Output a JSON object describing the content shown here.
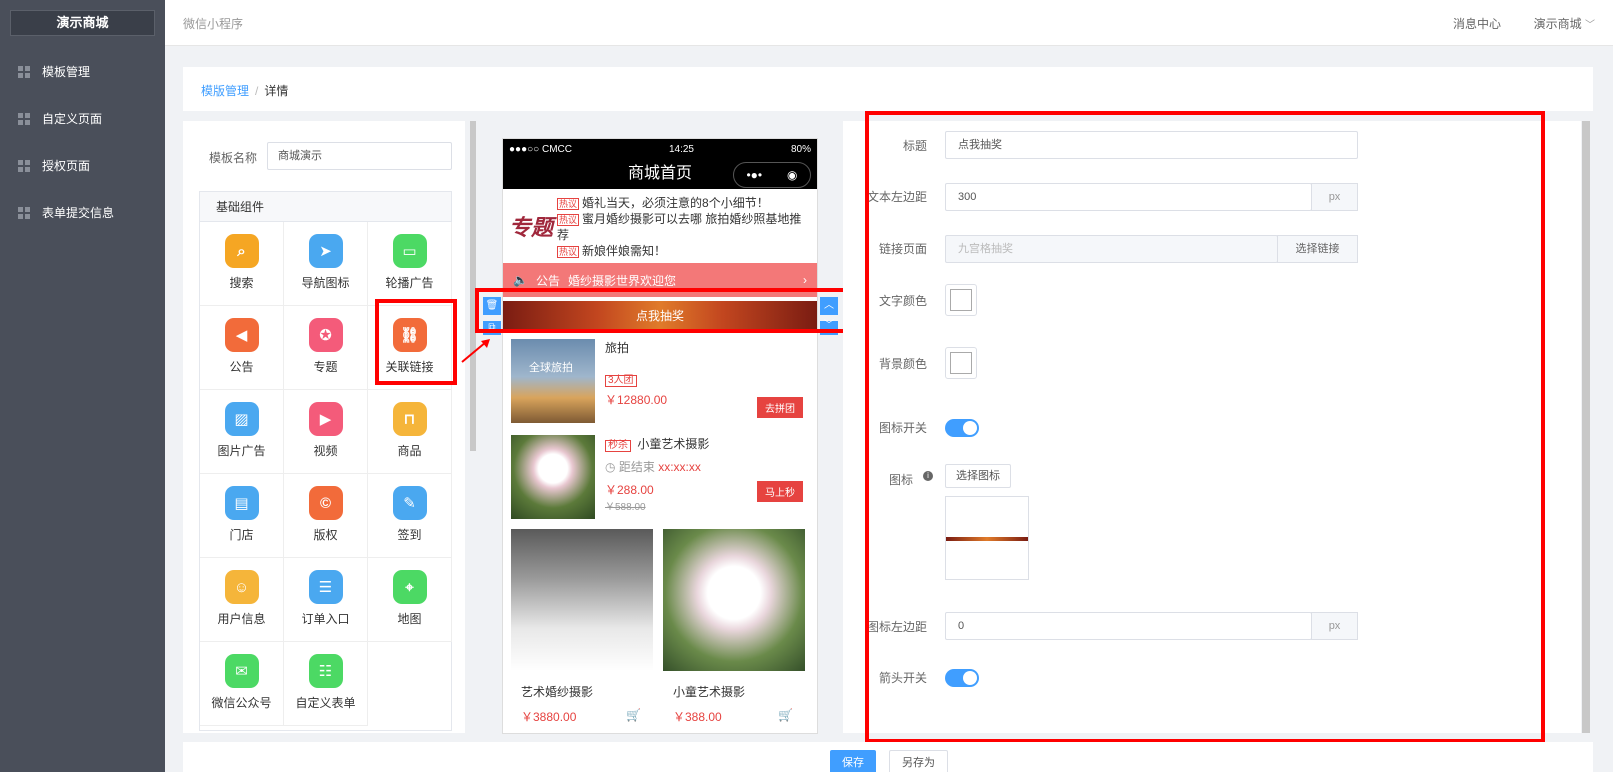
{
  "sidebar": {
    "logo": "演示商城",
    "items": [
      {
        "label": "模板管理"
      },
      {
        "label": "自定义页面"
      },
      {
        "label": "授权页面"
      },
      {
        "label": "表单提交信息"
      }
    ]
  },
  "topbar": {
    "subtitle": "微信小程序",
    "message_center": "消息中心",
    "shop_menu": "演示商城"
  },
  "breadcrumb": {
    "root": "模版管理",
    "separator": "/",
    "current": "详情"
  },
  "template": {
    "name_label": "模板名称",
    "name_value": "商城演示"
  },
  "components": {
    "title": "基础组件",
    "items": [
      {
        "label": "搜索",
        "icon": "search-icon",
        "color": "#f5a623"
      },
      {
        "label": "导航图标",
        "icon": "navigation-icon",
        "color": "#4aa8f0"
      },
      {
        "label": "轮播广告",
        "icon": "carousel-icon",
        "color": "#4cd964"
      },
      {
        "label": "公告",
        "icon": "speaker-icon",
        "color": "#f26b3a"
      },
      {
        "label": "专题",
        "icon": "topic-icon",
        "color": "#f45b7a"
      },
      {
        "label": "关联链接",
        "icon": "link-icon",
        "color": "#f26b3a"
      },
      {
        "label": "图片广告",
        "icon": "image-icon",
        "color": "#4aa8f0"
      },
      {
        "label": "视频",
        "icon": "video-icon",
        "color": "#f45b7a"
      },
      {
        "label": "商品",
        "icon": "bag-icon",
        "color": "#f5b53a"
      },
      {
        "label": "门店",
        "icon": "store-icon",
        "color": "#4aa8f0"
      },
      {
        "label": "版权",
        "icon": "copyright-icon",
        "color": "#f26b3a"
      },
      {
        "label": "签到",
        "icon": "pencil-icon",
        "color": "#4aa8f0"
      },
      {
        "label": "用户信息",
        "icon": "user-icon",
        "color": "#f5b53a"
      },
      {
        "label": "订单入口",
        "icon": "clipboard-icon",
        "color": "#4aa8f0"
      },
      {
        "label": "地图",
        "icon": "map-pin-icon",
        "color": "#4cd964"
      },
      {
        "label": "微信公众号",
        "icon": "wechat-icon",
        "color": "#4cd964"
      },
      {
        "label": "自定义表单",
        "icon": "form-icon",
        "color": "#4cd964"
      }
    ]
  },
  "phone": {
    "carrier": "●●●○○ CMCC",
    "time": "14:25",
    "battery": "80%",
    "page_title": "商城首页",
    "topic_logo": "专题",
    "hot_tag": "热议",
    "topics": [
      "婚礼当天，必须注意的8个小细节！",
      "蜜月婚纱摄影可以去哪 旅拍婚纱照基地推荐",
      "新娘伴娘需知！"
    ],
    "notice_label": "公告",
    "notice_text": "婚纱摄影世界欢迎您",
    "link_text": "点我抽奖",
    "products": [
      {
        "name": "旅拍",
        "image_text": "全球旅拍",
        "tag": "3人团",
        "price": "￥12880.00",
        "button": "去拼团"
      },
      {
        "name": "小童艺术摄影",
        "tag": "秒杀",
        "countdown_label": "距结束",
        "countdown": "xx:xx:xx",
        "price": "￥288.00",
        "old_price": "￥588.00",
        "button": "马上秒"
      }
    ],
    "grid_products": [
      {
        "name": "艺术婚纱摄影",
        "price": "￥3880.00"
      },
      {
        "name": "小童艺术摄影",
        "price": "￥388.00"
      }
    ]
  },
  "form": {
    "title_label": "标题",
    "title_value": "点我抽奖",
    "text_margin_label": "文本左边距",
    "text_margin_value": "300",
    "unit": "px",
    "link_page_label": "链接页面",
    "link_page_value": "九宫格抽奖",
    "select_link": "选择链接",
    "text_color_label": "文字颜色",
    "bg_color_label": "背景颜色",
    "icon_switch_label": "图标开关",
    "icon_label": "图标",
    "select_icon": "选择图标",
    "icon_margin_label": "图标左边距",
    "icon_margin_value": "0",
    "arrow_switch_label": "箭头开关"
  },
  "footer": {
    "save": "保存",
    "save_as": "另存为"
  },
  "colors": {
    "accent": "#409eff",
    "highlight": "#ff0000",
    "sidebar": "#4a4f5a"
  }
}
